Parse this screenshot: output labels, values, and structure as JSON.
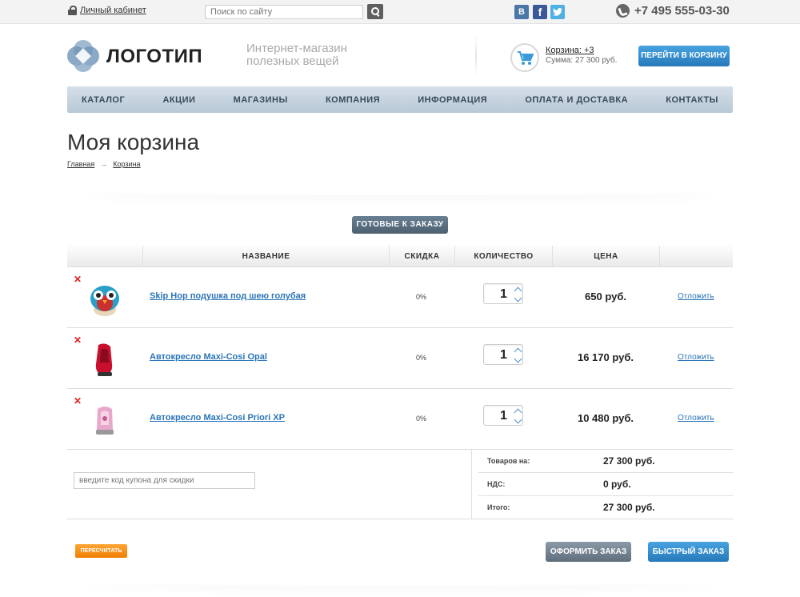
{
  "topbar": {
    "cabinet_label": "Личный кабинет",
    "search_placeholder": "Поиск по сайту",
    "social": [
      "vk-icon",
      "facebook-icon",
      "twitter-icon"
    ],
    "phone": "+7 495 555-03-30"
  },
  "header": {
    "logo_text": "ЛОГОТИП",
    "tagline_line1": "Интернет-магазин",
    "tagline_line2": "полезных вещей",
    "cart_link": "Корзина: +3",
    "cart_sum": "Сумма: 27 300 руб.",
    "go_cart_label": "ПЕРЕЙТИ В КОРЗИНУ"
  },
  "nav": {
    "items": [
      "КАТАЛОГ",
      "АКЦИИ",
      "МАГАЗИНЫ",
      "КОМПАНИЯ",
      "ИНФОРМАЦИЯ",
      "ОПЛАТА И ДОСТАВКА",
      "КОНТАКТЫ"
    ]
  },
  "page": {
    "title": "Моя корзина",
    "breadcrumb_home": "Главная",
    "breadcrumb_arrow": "→",
    "breadcrumb_current": "Корзина",
    "ready_label": "ГОТОВЫЕ К ЗАКАЗУ"
  },
  "table": {
    "headers": {
      "name": "НАЗВАНИЕ",
      "discount": "СКИДКА",
      "quantity": "КОЛИЧЕСТВО",
      "price": "ЦЕНА"
    },
    "rows": [
      {
        "name": "Skip Hop подушка под шею голубая",
        "discount": "0%",
        "qty": "1",
        "price": "650 руб.",
        "defer": "Отложить"
      },
      {
        "name": "Автокресло Maxi-Cosi Opal",
        "discount": "0%",
        "qty": "1",
        "price": "16 170 руб.",
        "defer": "Отложить"
      },
      {
        "name": "Автокресло Maxi-Cosi Priori XP",
        "discount": "0%",
        "qty": "1",
        "price": "10 480 руб.",
        "defer": "Отложить"
      }
    ],
    "delete_glyph": "✕"
  },
  "coupon": {
    "placeholder": "введите код купона для скидки"
  },
  "totals": {
    "goods_label": "Товаров на:",
    "goods_value": "27 300 руб.",
    "vat_label": "НДС:",
    "vat_value": "0 руб.",
    "total_label": "Итого:",
    "total_value": "27 300 руб."
  },
  "actions": {
    "recalc": "ПЕРЕСЧИТАТЬ",
    "checkout": "ОФОРМИТЬ ЗАКАЗ",
    "fast_order": "БЫСТРЫЙ ЗАКАЗ"
  },
  "colors": {
    "accent_blue": "#2779b9",
    "link_blue": "#2a74b8",
    "orange": "#f07e00",
    "delete_red": "#e02020"
  }
}
